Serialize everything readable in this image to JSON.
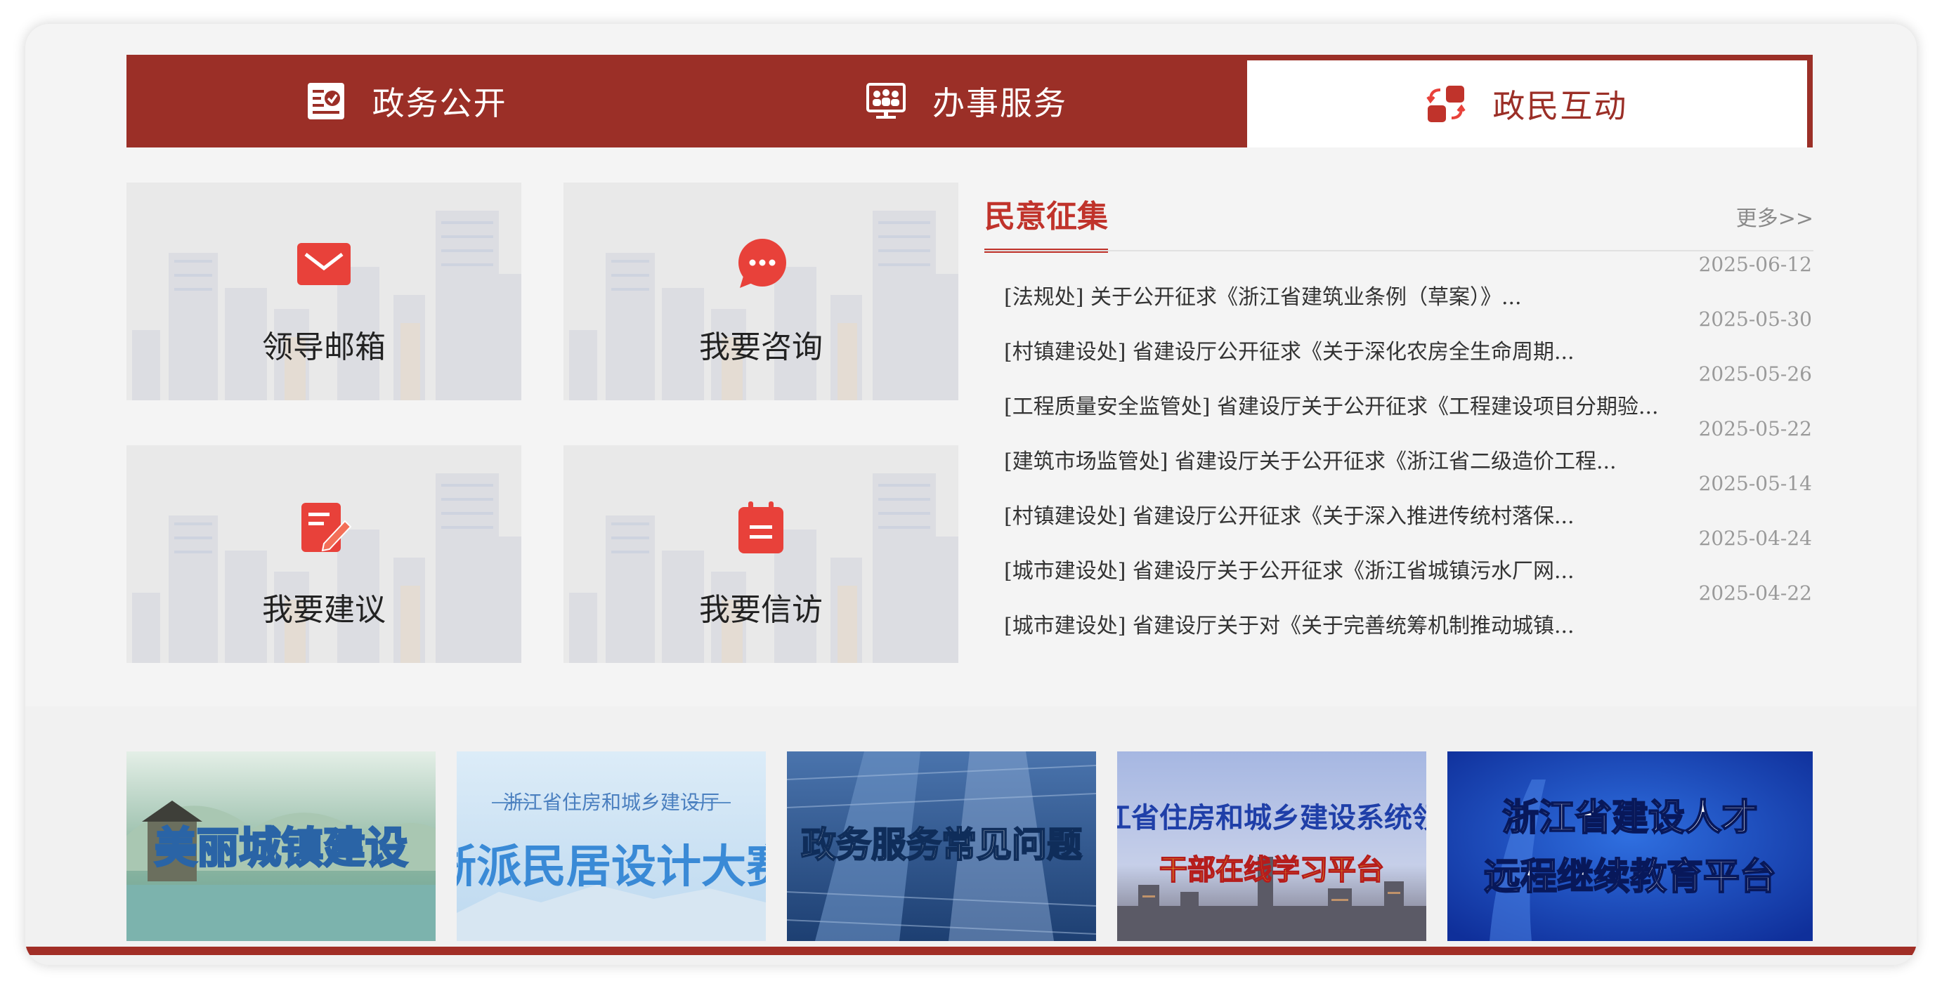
{
  "tabs": [
    {
      "label": "政务公开",
      "icon": "document-check-icon",
      "active": false
    },
    {
      "label": "办事服务",
      "icon": "people-monitor-icon",
      "active": false
    },
    {
      "label": "政民互动",
      "icon": "interaction-icon",
      "active": true
    }
  ],
  "tiles": [
    {
      "label": "领导邮箱",
      "icon": "envelope-icon"
    },
    {
      "label": "我要咨询",
      "icon": "chat-bubble-icon"
    },
    {
      "label": "我要建议",
      "icon": "edit-note-icon"
    },
    {
      "label": "我要信访",
      "icon": "clipboard-icon"
    }
  ],
  "news": {
    "title": "民意征集",
    "more": "更多>>",
    "items": [
      {
        "date": "2025-06-12",
        "text": "[法规处] 关于公开征求《浙江省建筑业条例（草案）》..."
      },
      {
        "date": "2025-05-30",
        "text": "[村镇建设处] 省建设厅公开征求《关于深化农房全生命周期..."
      },
      {
        "date": "2025-05-26",
        "text": "[工程质量安全监管处] 省建设厅关于公开征求《工程建设项目分期验..."
      },
      {
        "date": "2025-05-22",
        "text": "[建筑市场监管处] 省建设厅关于公开征求《浙江省二级造价工程..."
      },
      {
        "date": "2025-05-14",
        "text": "[村镇建设处] 省建设厅公开征求《关于深入推进传统村落保..."
      },
      {
        "date": "2025-04-24",
        "text": "[城市建设处] 省建设厅关于公开征求《浙江省城镇污水厂网..."
      },
      {
        "date": "2025-04-22",
        "text": "[城市建设处] 省建设厅关于对《关于完善统筹机制推动城镇..."
      }
    ]
  },
  "banners": [
    {
      "line1": "美丽城镇建设"
    },
    {
      "line1": "浙江省住房和城乡建设厅",
      "line2": "浙派民居设计大赛"
    },
    {
      "line1": "政务服务常见问题"
    },
    {
      "line1": "浙江省住房和城乡建设系统领导",
      "line2": "干部在线学习平台"
    },
    {
      "line1": "浙江省建设人才",
      "line2": "远程继续教育平台"
    }
  ],
  "colors": {
    "brand_red": "#9b2f27",
    "accent_red": "#c0332b",
    "icon_red": "#e8413a"
  }
}
